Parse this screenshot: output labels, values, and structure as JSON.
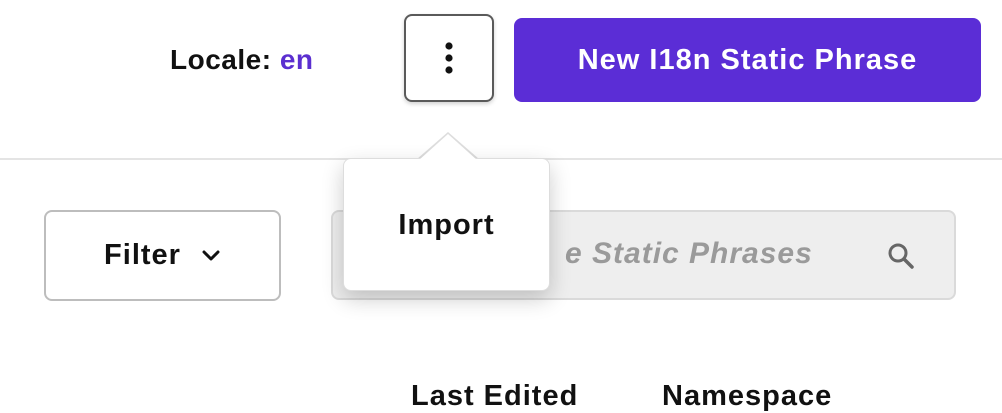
{
  "header": {
    "locale_label": "Locale:",
    "locale_value": "en",
    "more_icon": "vertical-ellipsis-icon",
    "new_button_label": "New I18n Static Phrase"
  },
  "dropdown_menu": {
    "items": [
      {
        "label": "Import"
      }
    ]
  },
  "toolbar": {
    "filter_label": "Filter",
    "filter_icon": "chevron-down-icon",
    "search_placeholder_visible": "e Static Phrases",
    "search_icon": "search-icon"
  },
  "table": {
    "columns": [
      {
        "label": "Last Edited"
      },
      {
        "label": "Namespace"
      }
    ]
  },
  "colors": {
    "accent": "#5b2dd6",
    "locale_value": "#5b2fd0",
    "search_bg": "#eeeeee"
  }
}
